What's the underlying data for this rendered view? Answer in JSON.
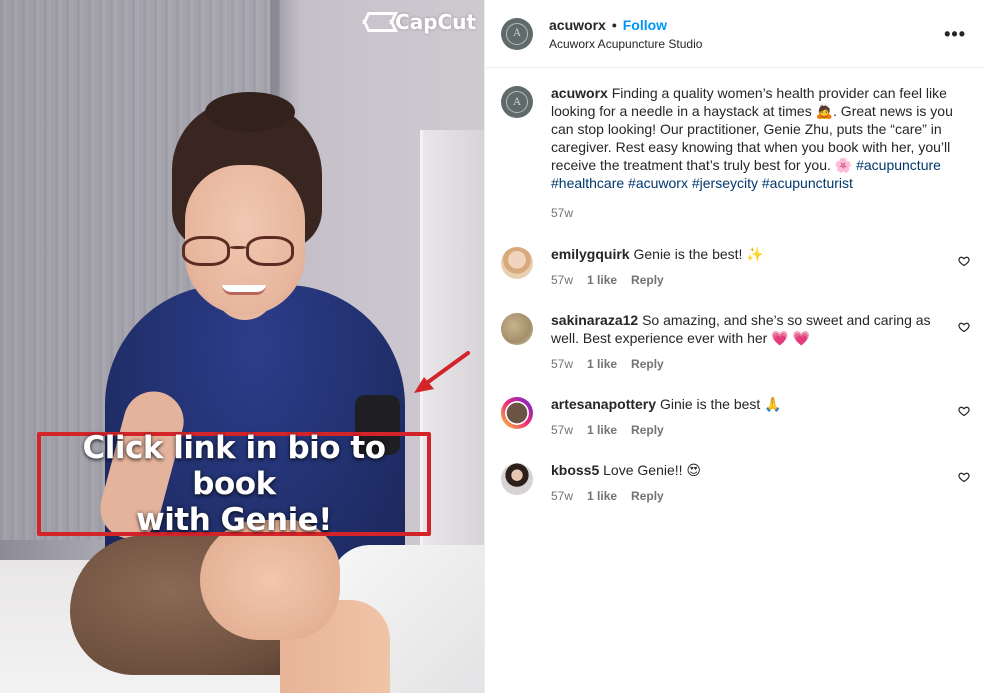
{
  "media": {
    "watermark": "CapCut",
    "cta_line1": "Click link in bio to book",
    "cta_line2": "with Genie!",
    "accent_color": "#d3242a"
  },
  "header": {
    "username": "acuworx",
    "separator": "•",
    "follow_label": "Follow",
    "subtitle": "Acuworx Acupuncture Studio",
    "more_label": "•••",
    "avatar_letter": "A"
  },
  "caption": {
    "username": "acuworx",
    "text": "Finding a quality women’s health provider can feel like looking for a needle in a haystack at times 🙇. Great news is you can stop looking! Our practitioner, Genie Zhu, puts the “care” in caregiver. Rest easy knowing that when you book with her, you’ll receive the treatment that’s truly best for you. 🌸",
    "hashtags": "#acupuncture #healthcare #acuworx #jerseycity #acupuncturist",
    "time": "57w",
    "avatar_letter": "A"
  },
  "comments": [
    {
      "username": "emilygquirk",
      "text": "Genie is the best! ✨",
      "time": "57w",
      "likes": "1 like",
      "reply": "Reply"
    },
    {
      "username": "sakinaraza12",
      "text": "So amazing, and she’s so sweet and caring as well. Best experience ever with her 💗 💗",
      "time": "57w",
      "likes": "1 like",
      "reply": "Reply"
    },
    {
      "username": "artesanapottery",
      "text": "Ginie is the best 🙏",
      "time": "57w",
      "likes": "1 like",
      "reply": "Reply"
    },
    {
      "username": "kboss5",
      "text": "Love Genie!! 😍",
      "time": "57w",
      "likes": "1 like",
      "reply": "Reply"
    }
  ],
  "colors": {
    "link": "#0095f6",
    "hashtag": "#00376b",
    "muted": "#737373",
    "text": "#262626"
  }
}
